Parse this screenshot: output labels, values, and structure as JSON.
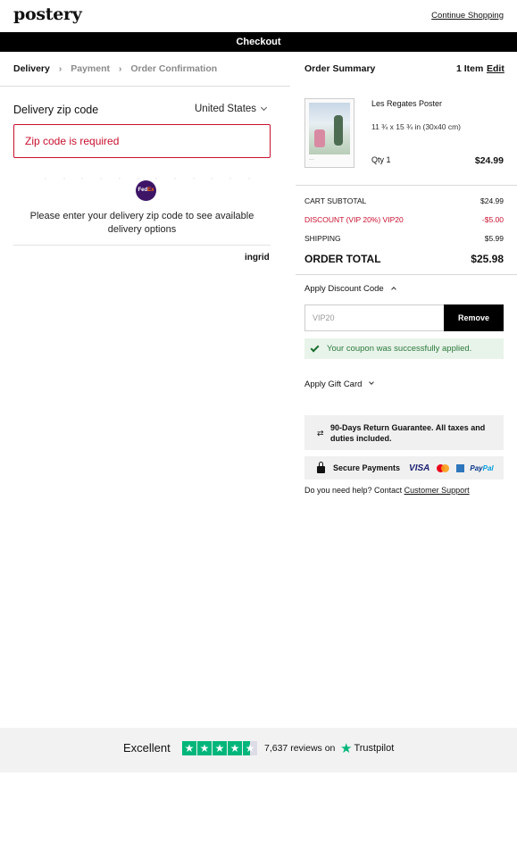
{
  "header": {
    "logo": "postery",
    "continue_label": "Continue Shopping",
    "checkout_title": "Checkout"
  },
  "steps": [
    {
      "label": "Delivery",
      "active": true
    },
    {
      "label": "Payment",
      "active": false
    },
    {
      "label": "Order Confirmation",
      "active": false
    }
  ],
  "delivery": {
    "zip_label": "Delivery zip code",
    "country": "United States",
    "zip_error": "Zip code is required",
    "carrier_badge": {
      "fed": "Fed",
      "ex": "Ex"
    },
    "message": "Please enter your delivery zip code to see available delivery options",
    "provider": "ingrid"
  },
  "summary": {
    "title": "Order Summary",
    "items_count": "1 Item",
    "edit_label": "Edit",
    "product": {
      "name": "Les Regates Poster",
      "size": "11 ¾ x 15 ¾ in (30x40 cm)",
      "qty": "Qty 1",
      "price": "$24.99"
    },
    "lines": {
      "subtotal_label": "CART SUBTOTAL",
      "subtotal_value": "$24.99",
      "discount_label": "DISCOUNT (VIP 20%) VIP20",
      "discount_value": "-$5.00",
      "shipping_label": "SHIPPING",
      "shipping_value": "$5.99",
      "total_label": "ORDER TOTAL",
      "total_value": "$25.98"
    },
    "discount": {
      "toggle_label": "Apply Discount Code",
      "code_value": "VIP20",
      "remove_label": "Remove",
      "success_message": "Your coupon was successfully applied."
    },
    "gift_card_label": "Apply Gift Card",
    "guarantee": "90-Days Return Guarantee. All taxes and duties included.",
    "secure_label": "Secure Payments",
    "payment_methods": {
      "visa": "VISA",
      "paypal_pay": "Pay",
      "paypal_pal": "Pal"
    },
    "help_text": "Do you need help? Contact",
    "help_link": "Customer Support"
  },
  "trustpilot": {
    "rating_word": "Excellent",
    "reviews_text": "7,637 reviews on",
    "brand": "Trustpilot",
    "rating": 4.5
  },
  "colors": {
    "accent_error": "#c8102e",
    "success": "#2b7a3b",
    "trustpilot_green": "#00b67a"
  }
}
